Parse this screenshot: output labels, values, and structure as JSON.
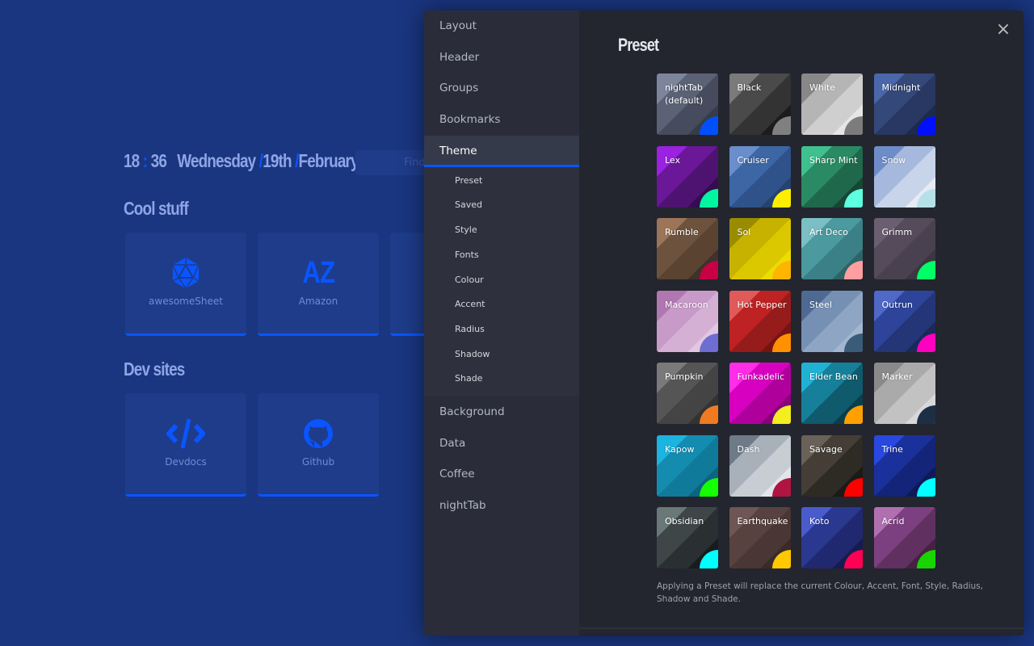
{
  "header": {
    "hours": "18",
    "minutes": "36",
    "colon": ":",
    "day": "Wednesday",
    "date": "19th",
    "month": "February",
    "slash": "/",
    "search_placeholder": "Find"
  },
  "groups": [
    {
      "title": "Cool stuff",
      "bookmarks": [
        {
          "name": "awesomeSheet",
          "icon": "d20-icon"
        },
        {
          "name": "Amazon",
          "icon": "letters-AZ",
          "letters": "AZ"
        }
      ]
    },
    {
      "title": "Dev sites",
      "bookmarks": [
        {
          "name": "Devdocs",
          "icon": "code-icon"
        },
        {
          "name": "Github",
          "icon": "github-icon"
        }
      ]
    }
  ],
  "menu": {
    "items": [
      "Layout",
      "Header",
      "Groups",
      "Bookmarks",
      "Theme",
      "Background",
      "Data",
      "Coffee",
      "nightTab"
    ],
    "active": "Theme",
    "theme_sub": [
      "Preset",
      "Saved",
      "Style",
      "Fonts",
      "Colour",
      "Accent",
      "Radius",
      "Shadow",
      "Shade"
    ]
  },
  "content": {
    "title": "Preset",
    "close": "×",
    "note": "Applying a Preset will replace the current Colour, Accent, Font, Style, Radius, Shadow and Shade.",
    "presets": [
      {
        "name": "nightTab (default)",
        "colors": [
          "#7d859b",
          "#5b6276",
          "#464c5d",
          "#373c4a"
        ],
        "accent": "#0050ff"
      },
      {
        "name": "Black",
        "colors": [
          "#7a7a7a",
          "#4a4a4a",
          "#333333",
          "#1c1c1c"
        ],
        "accent": "#808080"
      },
      {
        "name": "White",
        "colors": [
          "#888888",
          "#b5b5b5",
          "#cfcfcf",
          "#e6e6e6"
        ],
        "accent": "#7c7c7c"
      },
      {
        "name": "Midnight",
        "colors": [
          "#4a67aa",
          "#34487a",
          "#283863",
          "#1d2a4a"
        ],
        "accent": "#0010ff"
      },
      {
        "name": "Lex",
        "colors": [
          "#9a22e0",
          "#6a1798",
          "#4e1370",
          "#360c50"
        ],
        "accent": "#00f5a0"
      },
      {
        "name": "Cruiser",
        "colors": [
          "#6a8ecb",
          "#3c66a4",
          "#2e5289",
          "#254270"
        ],
        "accent": "#ffee00"
      },
      {
        "name": "Sharp Mint",
        "colors": [
          "#3fc08e",
          "#2a8a63",
          "#1f684b",
          "#174634"
        ],
        "accent": "#5effe0"
      },
      {
        "name": "Snow",
        "colors": [
          "#6e8cc8",
          "#a6b9dc",
          "#c7d4ea",
          "#e6ebf4"
        ],
        "accent": "#b6e0e8"
      },
      {
        "name": "Rumble",
        "colors": [
          "#9c7558",
          "#6d533e",
          "#5b4332",
          "#42302a"
        ],
        "accent": "#c80044"
      },
      {
        "name": "Sol",
        "colors": [
          "#9a8c00",
          "#c8b200",
          "#dcc800",
          "#ecdc00"
        ],
        "accent": "#ffb400"
      },
      {
        "name": "Art Deco",
        "colors": [
          "#7bbfc4",
          "#4a9aa0",
          "#3b8086",
          "#2d6468"
        ],
        "accent": "#ff9e9e"
      },
      {
        "name": "Grimm",
        "colors": [
          "#6a5f70",
          "#554b5a",
          "#4a4150",
          "#3d3542"
        ],
        "accent": "#00ff66"
      },
      {
        "name": "Macaroon",
        "colors": [
          "#b077b0",
          "#c89ac8",
          "#d4b0d4",
          "#e2c6e2"
        ],
        "accent": "#6e6ed2"
      },
      {
        "name": "Hot Pepper",
        "colors": [
          "#e05a5a",
          "#be2222",
          "#961c1c",
          "#761414"
        ],
        "accent": "#ff9000"
      },
      {
        "name": "Steel",
        "colors": [
          "#4e6a92",
          "#7690b4",
          "#8ea6c4",
          "#a2b6d0"
        ],
        "accent": "#3a5c78"
      },
      {
        "name": "Outrun",
        "colors": [
          "#5068c8",
          "#2e449a",
          "#243678",
          "#1c2858"
        ],
        "accent": "#ff00c0"
      },
      {
        "name": "Pumpkin",
        "colors": [
          "#7a7a7a",
          "#555555",
          "#444444",
          "#333333"
        ],
        "accent": "#f07a20"
      },
      {
        "name": "Funkadelic",
        "colors": [
          "#ff2ce8",
          "#d800c0",
          "#b0009c",
          "#88007a"
        ],
        "accent": "#f2ee20"
      },
      {
        "name": "Elder Bean",
        "colors": [
          "#20b2d4",
          "#16809a",
          "#0f5a6c",
          "#0a3e4a"
        ],
        "accent": "#ffa000"
      },
      {
        "name": "Marker",
        "colors": [
          "#8a8a8a",
          "#aaaaaa",
          "#c2c2c2",
          "#d8d8d8"
        ],
        "accent": "#1e2e44"
      },
      {
        "name": "Kapow",
        "colors": [
          "#1cb4e0",
          "#148cb0",
          "#107a9a",
          "#0c6480"
        ],
        "accent": "#14ff00"
      },
      {
        "name": "Dash",
        "colors": [
          "#6e7a88",
          "#a8b0ba",
          "#c8cdd4",
          "#e2e6ea"
        ],
        "accent": "#b01440"
      },
      {
        "name": "Savage",
        "colors": [
          "#6a6258",
          "#443e36",
          "#2e2a24",
          "#1c1a16"
        ],
        "accent": "#ff0000"
      },
      {
        "name": "Trine",
        "colors": [
          "#2848e0",
          "#1a309a",
          "#142478",
          "#0e1a58"
        ],
        "accent": "#00ffff"
      },
      {
        "name": "Obsidian",
        "colors": [
          "#6a7878",
          "#3e4648",
          "#2a3032",
          "#181c1e"
        ],
        "accent": "#00ffff"
      },
      {
        "name": "Earthquake",
        "colors": [
          "#6e5654",
          "#58423f",
          "#4a3634",
          "#3a2a28"
        ],
        "accent": "#ffc800"
      },
      {
        "name": "Koto",
        "colors": [
          "#4a5ccc",
          "#2a3890",
          "#202870",
          "#161c50"
        ],
        "accent": "#ff0055"
      },
      {
        "name": "Acrid",
        "colors": [
          "#b070b0",
          "#7c4080",
          "#603060",
          "#452242"
        ],
        "accent": "#18d400"
      }
    ]
  },
  "colors": {
    "background": "#1a3680",
    "accent": "#0a55ff",
    "panel": "#23252f",
    "sidebar": "#2a2d39"
  }
}
